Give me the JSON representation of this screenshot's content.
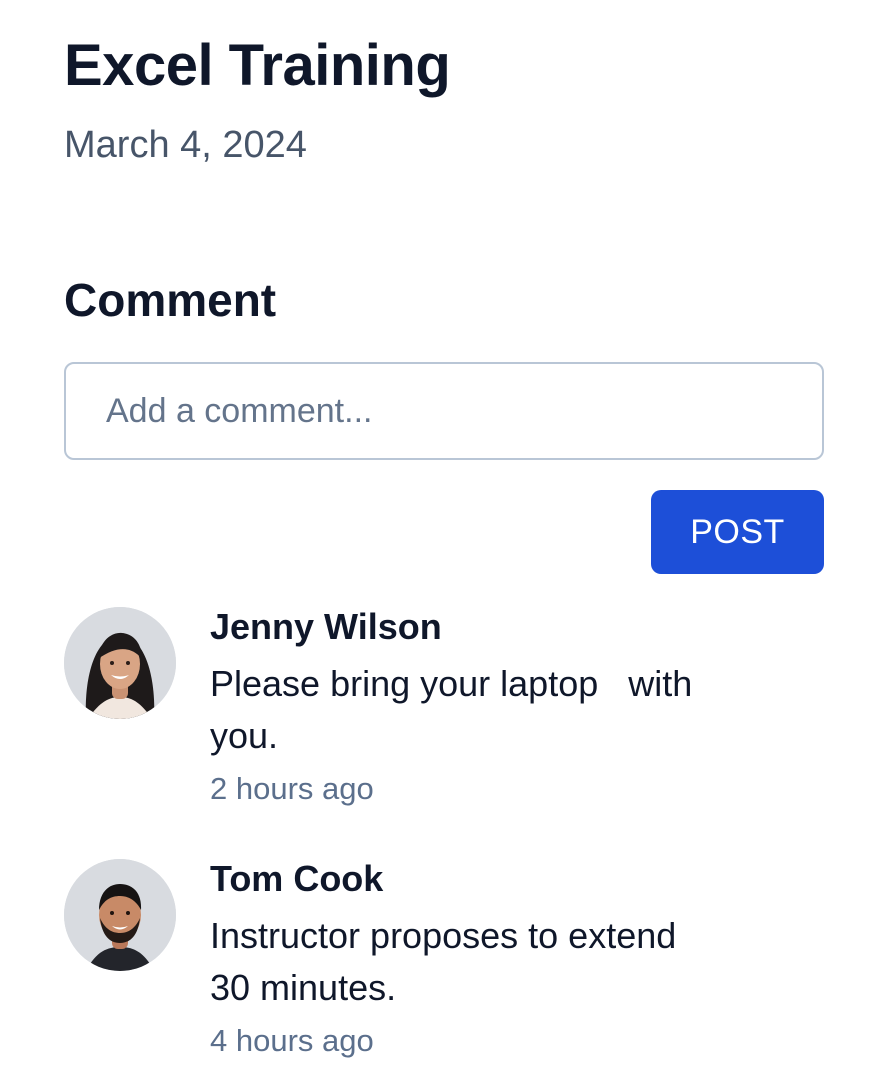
{
  "event": {
    "title": "Excel Training",
    "date": "March 4, 2024"
  },
  "comments_section": {
    "heading": "Comment",
    "input": {
      "placeholder": "Add a comment...",
      "value": ""
    },
    "post_label": "POST",
    "accent_color": "#1d4fd8"
  },
  "comments": [
    {
      "author": "Jenny Wilson",
      "line1": "Please bring your laptop   with",
      "line2": "you.",
      "time": "2 hours ago",
      "avatar_icon": "user-avatar"
    },
    {
      "author": "Tom Cook",
      "line1": "Instructor proposes to extend",
      "line2": "30 minutes.",
      "time": "4 hours ago",
      "avatar_icon": "user-avatar"
    }
  ]
}
